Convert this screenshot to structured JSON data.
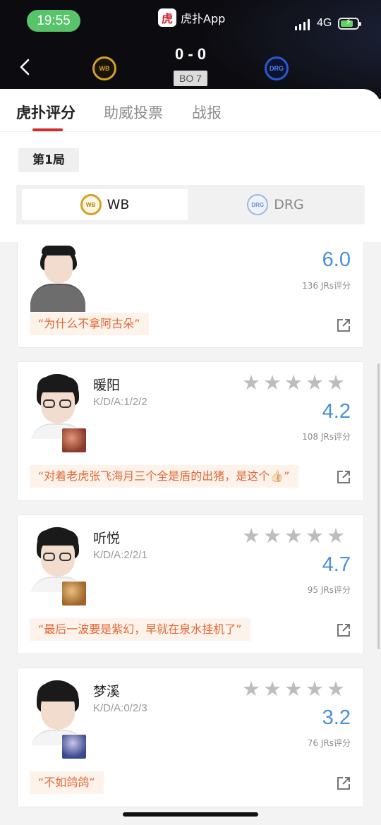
{
  "status_bar": {
    "time": "19:55",
    "network": "4G"
  },
  "app_pill": {
    "logo_char": "虎",
    "name": "虎扑App"
  },
  "match": {
    "score": "0 - 0",
    "format": "BO 7",
    "team_home": {
      "name": "WB",
      "logo_text": "WB",
      "color": "#d4a02a"
    },
    "team_away": {
      "name": "DRG",
      "logo_text": "DRG",
      "color": "#2a5ad0"
    }
  },
  "tabs": [
    {
      "label": "虎扑评分",
      "active": true
    },
    {
      "label": "助威投票",
      "active": false
    },
    {
      "label": "战报",
      "active": false
    }
  ],
  "round": "第1局",
  "team_switch": [
    {
      "label": "WB",
      "active": true
    },
    {
      "label": "DRG",
      "active": false
    }
  ],
  "rating_unit": "JRs评分",
  "players": [
    {
      "name": "",
      "kda": "",
      "score": "6.0",
      "votes": "136 JRs评分",
      "comment": "“为什么不拿阿古朵”",
      "hero_color": ""
    },
    {
      "name": "暖阳",
      "kda": "K/D/A:1/2/2",
      "score": "4.2",
      "votes": "108 JRs评分",
      "comment": "“对着老虎张飞海月三个全是盾的出猪，是这个👍🏻”",
      "hero_color": "#8b3a2a"
    },
    {
      "name": "听悦",
      "kda": "K/D/A:2/2/1",
      "score": "4.7",
      "votes": "95 JRs评分",
      "comment": "“最后一波要是紫幻，早就在泉水挂机了”",
      "hero_color": "#a0652a"
    },
    {
      "name": "梦溪",
      "kda": "K/D/A:0/2/3",
      "score": "3.2",
      "votes": "76 JRs评分",
      "comment": "“不如鸽鸽”",
      "hero_color": "#3b4a8f"
    }
  ],
  "icons": {
    "back": "chevron-left-icon",
    "share": "share-icon",
    "star": "star-icon"
  },
  "colors": {
    "accent": "#d42c2c",
    "score_blue": "#4a8fd8",
    "comment_text": "#e0683a"
  }
}
